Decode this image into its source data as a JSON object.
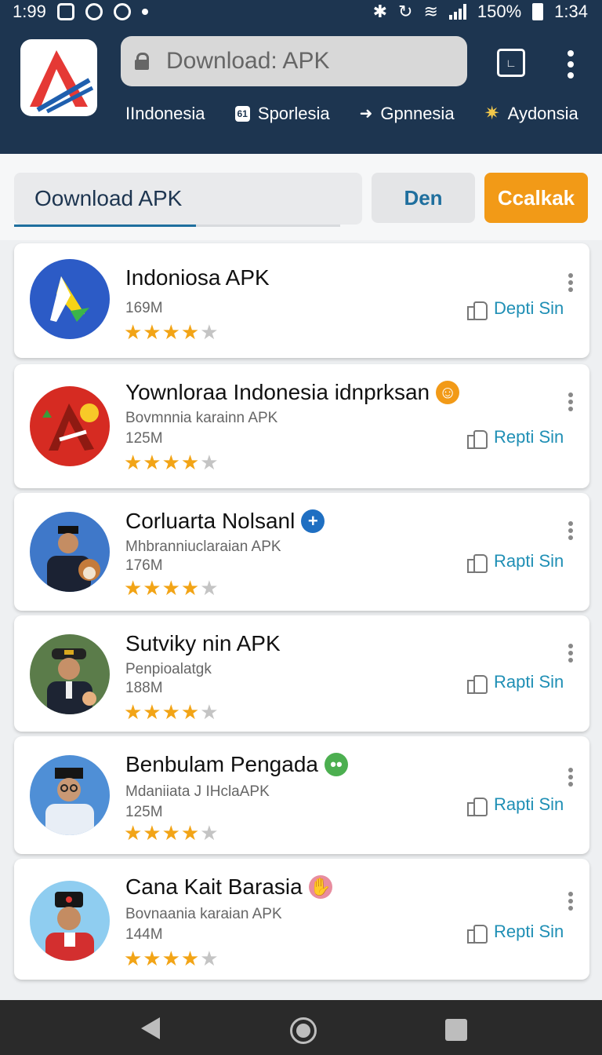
{
  "status_bar": {
    "time_left": "1:99",
    "battery_percent": "150%",
    "time_right": "1:34"
  },
  "header": {
    "url_text": "Download: APK",
    "nav_items": [
      {
        "label": "IIndonesia",
        "icon": ""
      },
      {
        "label": "Sporlesia",
        "icon": "61"
      },
      {
        "label": "Gpnnesia",
        "icon": "➜"
      },
      {
        "label": "Aydonsia",
        "icon": "✷"
      }
    ]
  },
  "search": {
    "value": "Oownload APK",
    "den_label": "Den",
    "search_label": "Ccalkak"
  },
  "colors": {
    "header_bg": "#1d3550",
    "accent": "#f29a17",
    "link": "#1f8fb5",
    "star": "#f2a416"
  },
  "apps": [
    {
      "title": "Indoniosa APK",
      "subtitle": "",
      "size": "169M",
      "rating": 4,
      "action": "Depti Sin",
      "emoji": "",
      "avatar_icon": "play-triangle-icon"
    },
    {
      "title": "Yownloraa Indonesia idnprksan",
      "subtitle": "Bovmnnia karainn APK",
      "size": "125M",
      "rating": 4,
      "action": "Repti Sin",
      "emoji": "laughing-emoji",
      "avatar_icon": "red-logo-icon"
    },
    {
      "title": "Corluarta Nolsanl",
      "subtitle": "Mhbranniuclaraian APK",
      "size": "176M",
      "rating": 4,
      "action": "Rapti Sin",
      "emoji": "plus-badge",
      "avatar_icon": "person-with-dog-icon"
    },
    {
      "title": "Sutviky nin APK",
      "subtitle": "Penpioalatgk",
      "size": "188M",
      "rating": 4,
      "action": "Rapti Sin",
      "emoji": "",
      "avatar_icon": "person-cap-icon"
    },
    {
      "title": "Benbulam Pengada",
      "subtitle": "Mdaniiata J IHclaAPK",
      "size": "125M",
      "rating": 4,
      "action": "Rapti Sin",
      "emoji": "green-face-emoji",
      "avatar_icon": "person-glasses-icon"
    },
    {
      "title": "Cana Kait Barasia",
      "subtitle": "Bovnaania karaian APK",
      "size": "144M",
      "rating": 4,
      "action": "Repti Sin",
      "emoji": "hand-emoji",
      "avatar_icon": "person-hat-icon"
    }
  ]
}
